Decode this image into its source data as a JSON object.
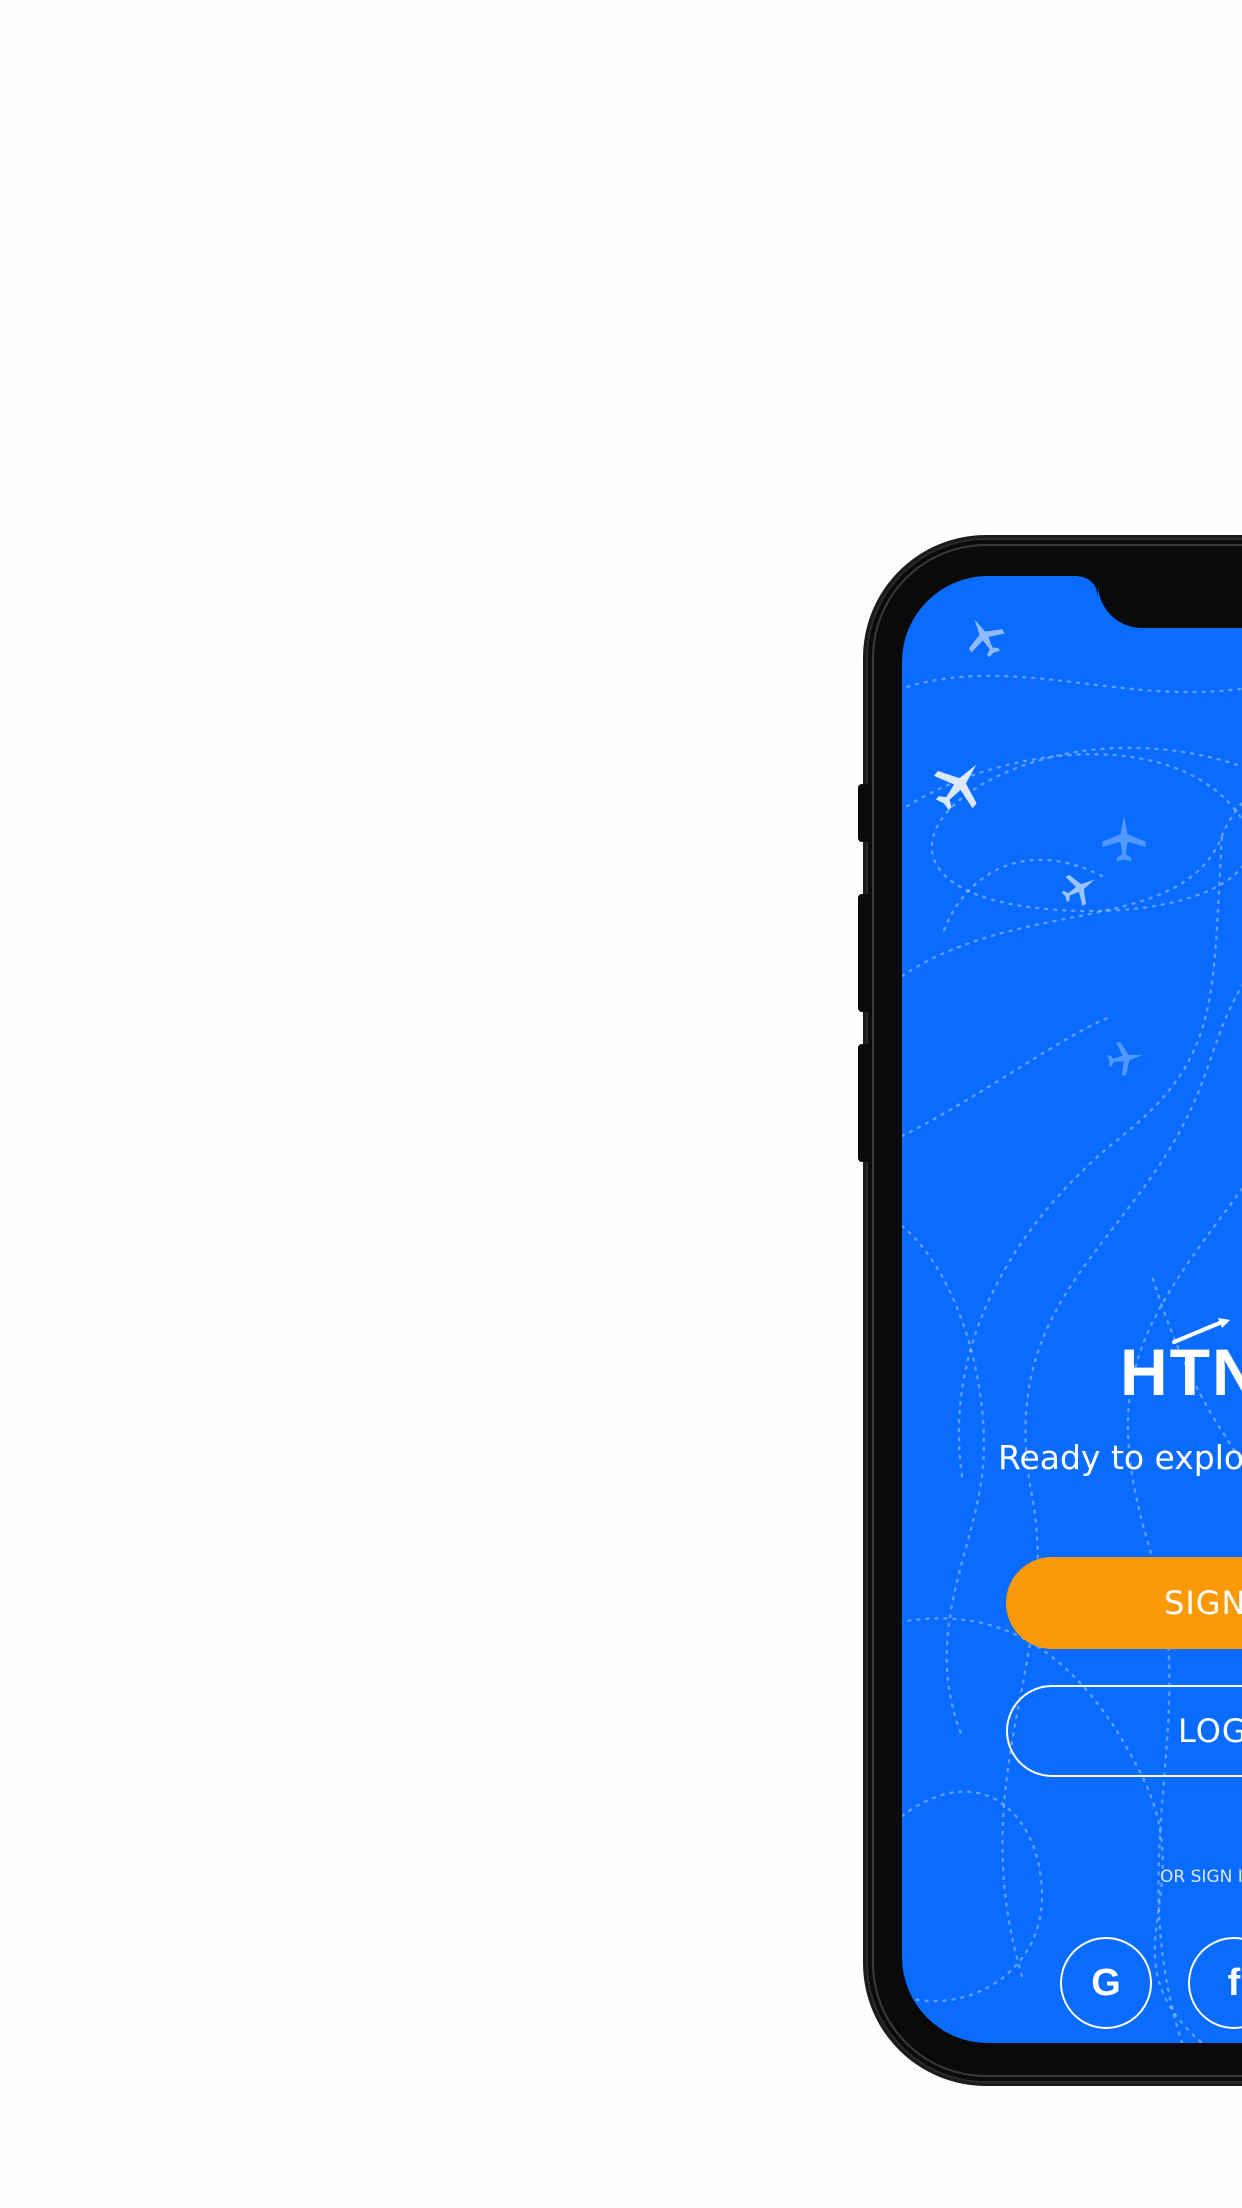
{
  "app": {
    "logo_text": "HTN",
    "tagline": "Ready to explo"
  },
  "actions": {
    "signup_label": "SIGN",
    "login_label": "LOG"
  },
  "social": {
    "divider_text": "OR SIGN IN",
    "google_glyph": "G",
    "facebook_glyph": "f"
  },
  "colors": {
    "screen_background": "#0a6cff",
    "signup_button": "#fb9a06",
    "text": "#ffffff",
    "page_background": "#fdfdfd"
  },
  "icons": {
    "background_pattern": "airplane-route-icon",
    "logo_mark": "airplane-icon",
    "google": "google-icon",
    "facebook": "facebook-icon"
  }
}
